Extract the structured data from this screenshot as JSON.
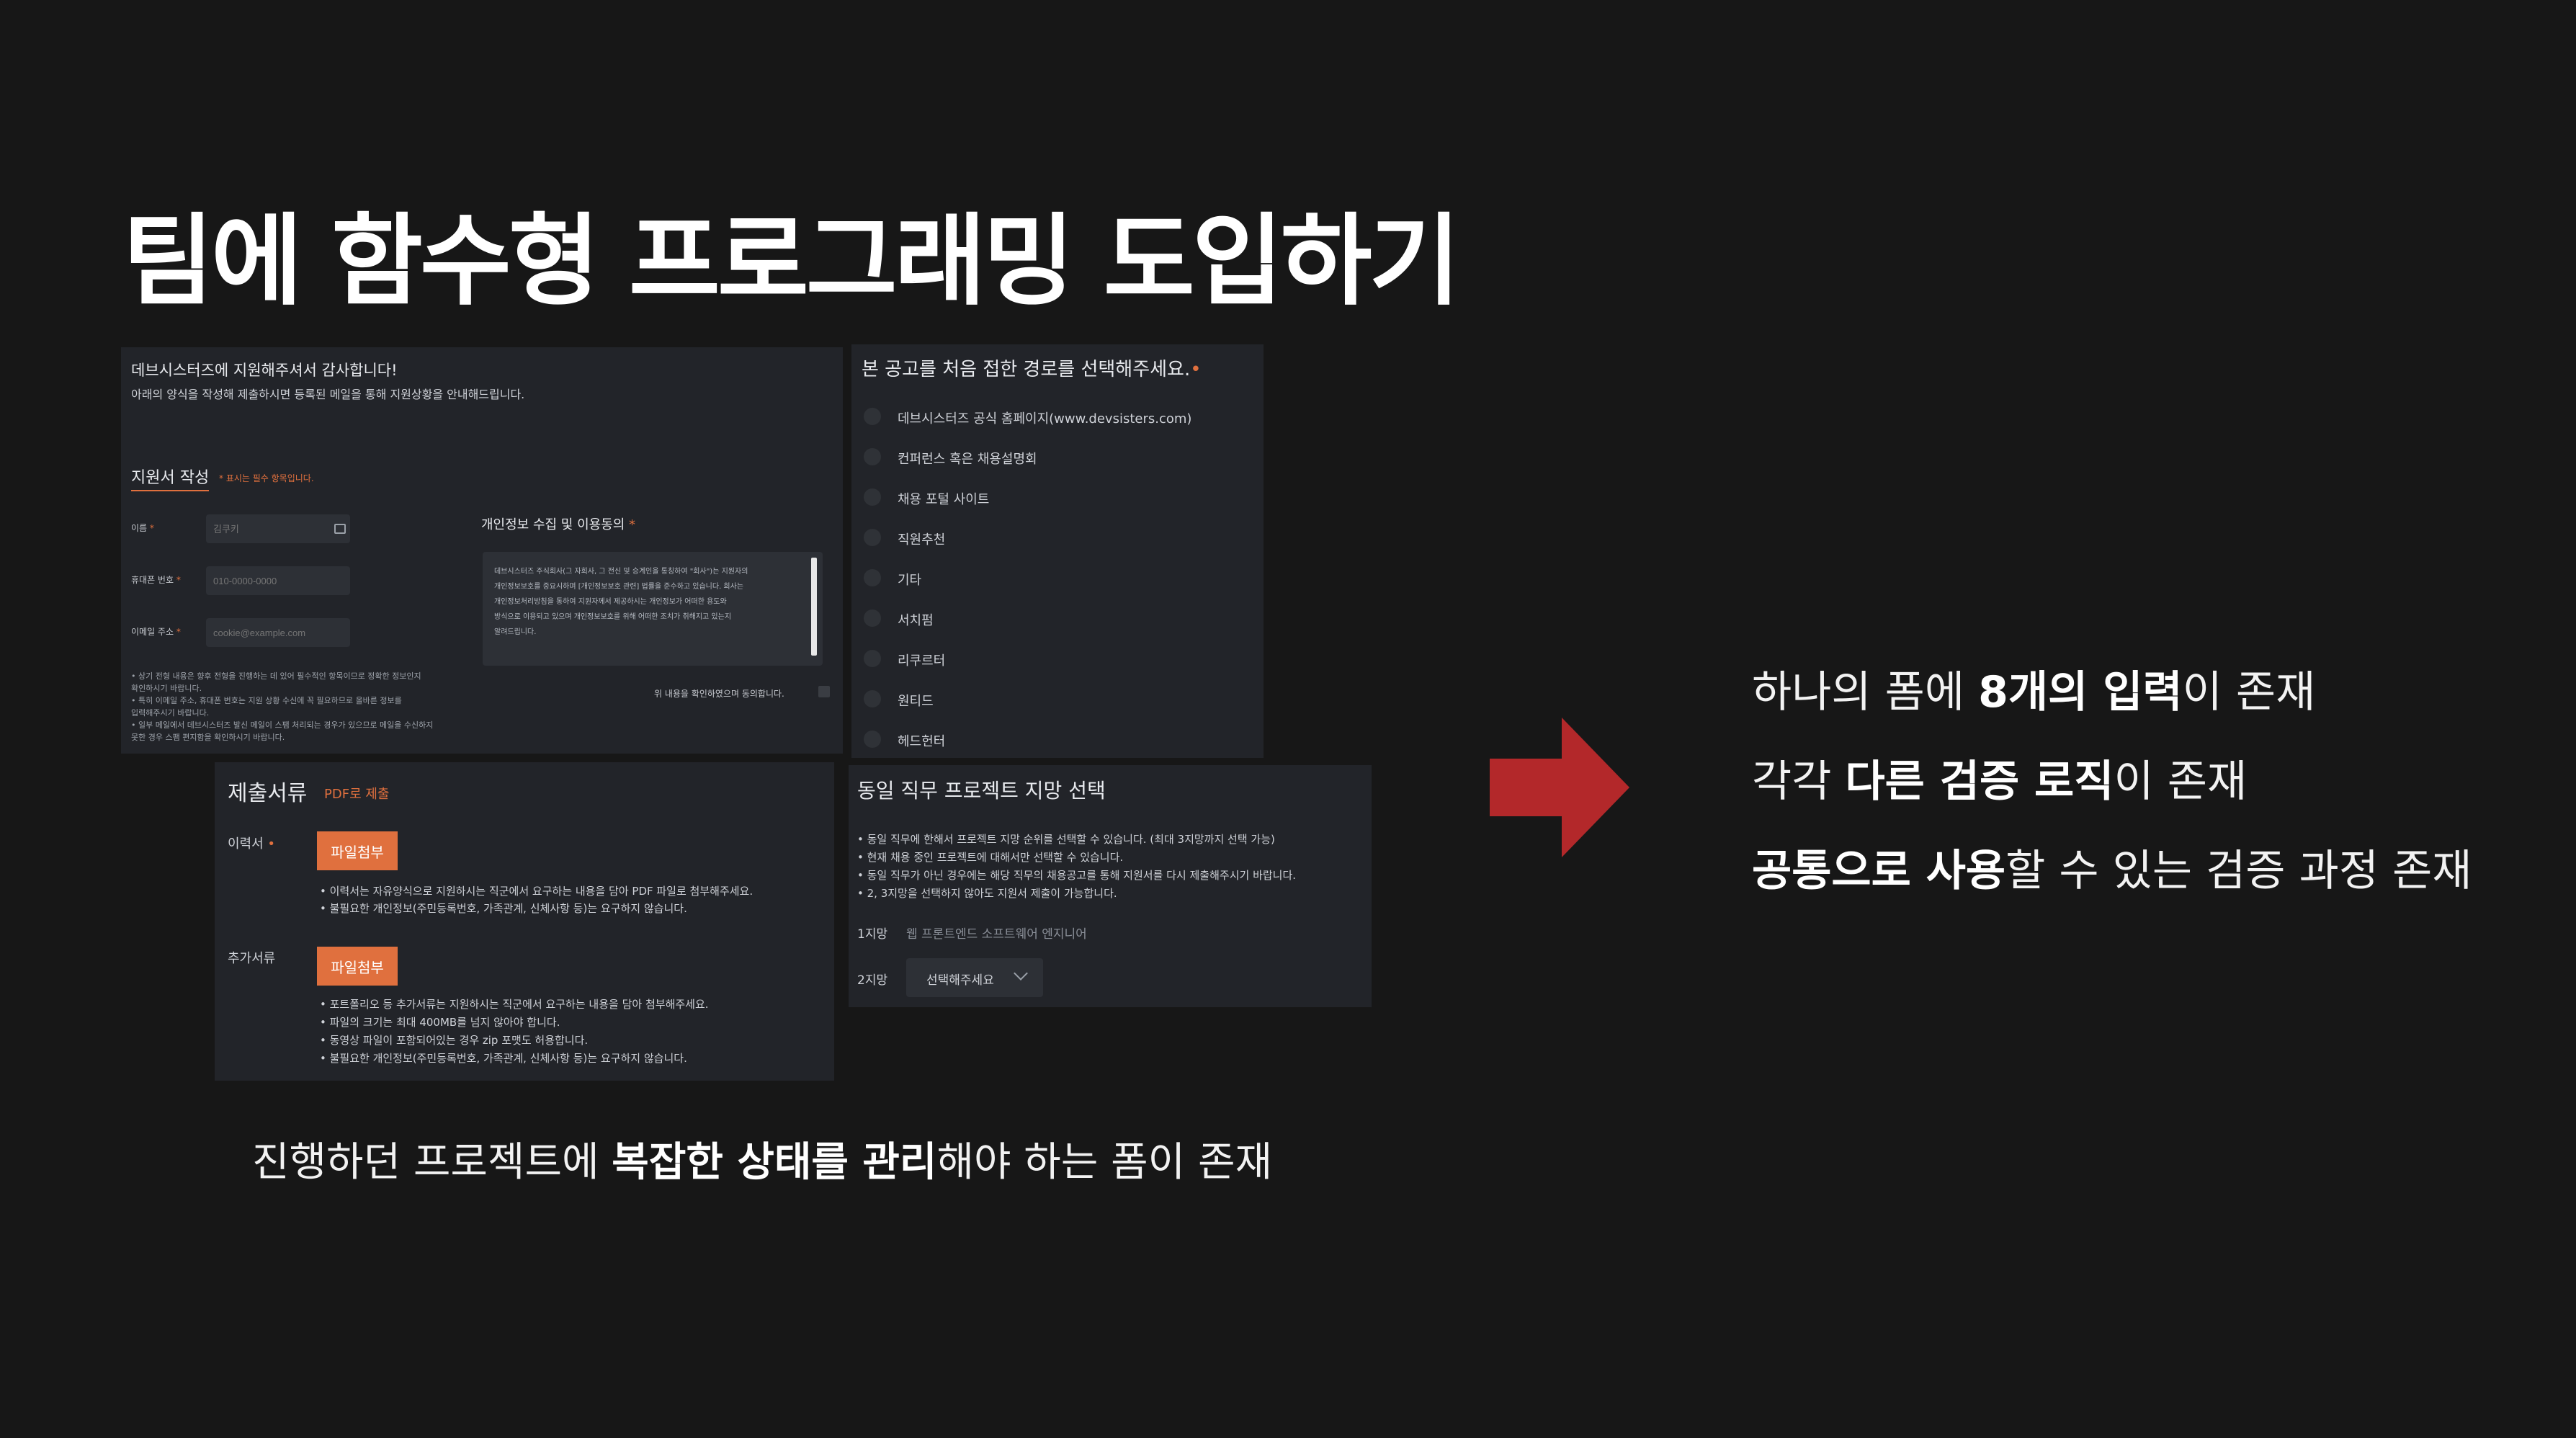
{
  "slide": {
    "title": "팀에 함수형 프로그래밍 도입하기",
    "bullets": [
      {
        "pre": "하나의 폼에 ",
        "bold": "8개의 입력",
        "post": "이 존재"
      },
      {
        "pre": "각각 ",
        "bold": "다른 검증 로직",
        "post": "이 존재"
      },
      {
        "pre": "",
        "bold": "공통으로 사용",
        "post": "할 수 있는 검증 과정 존재"
      }
    ],
    "caption": {
      "pre": "진행하던 프로젝트에 ",
      "bold": "복잡한 상태를 관리",
      "post": "해야 하는 폼이 존재"
    },
    "arrow_color": "#b3282a"
  },
  "form": {
    "heading": "데브시스터즈에 지원해주셔서 감사합니다!",
    "subheading": "아래의 양식을 작성해 제출하시면 등록된 메일을 통해 지원상황을 안내해드립니다.",
    "section_title": "지원서 작성",
    "required_note": "* 표시는 필수 항목입니다.",
    "name_label": "이름",
    "name_placeholder": "김쿠키",
    "phone_label": "휴대폰 번호",
    "phone_placeholder": "010-0000-0000",
    "email_label": "이메일 주소",
    "email_placeholder": "cookie@example.com",
    "notes": [
      "• 상기 전형 내용은 향후 전형을 진행하는 데 있어 필수적인 항목이므로 정확한 정보인지",
      "  확인하시기 바랍니다.",
      "• 특히 이메일 주소, 휴대폰 번호는 지원 상황 수신에 꼭 필요하므로 올바른 정보를",
      "  입력해주시기 바랍니다.",
      "• 일부 메일에서 데브시스터즈 발신 메일이 스팸 처리되는 경우가 있으므로 메일을 수신하지",
      "  못한 경우 스팸 편지함을 확인하시기 바랍니다."
    ],
    "privacy_title": "개인정보 수집 및 이용동의",
    "privacy_text": [
      "데브시스터즈 주식회사(그 자회사, 그 전신 및 승계인을 통칭하여 \"회사\")는 지원자의",
      "개인정보보호를 중요시하며 [개인정보보호 관련] 법률을 준수하고 있습니다. 회사는",
      "개인정보처리방침을 통하여 지원자께서 제공하시는 개인정보가 어떠한 용도와",
      "방식으로 이용되고 있으며 개인정보보호를 위해 어떠한 조치가 취해지고 있는지",
      "알려드립니다."
    ],
    "agree_text": "위 내용을 확인하였으며 동의합니다."
  },
  "source": {
    "question": "본 공고를 처음 접한 경로를 선택해주세요.",
    "options": [
      "데브시스터즈 공식 홈페이지(www.devsisters.com)",
      "컨퍼런스 혹은 채용설명회",
      "채용 포털 사이트",
      "직원추천",
      "기타",
      "서치펌",
      "리쿠르터",
      "원티드",
      "헤드헌터"
    ]
  },
  "docs": {
    "title": "제출서류",
    "note": "PDF로 제출",
    "resume_label": "이력서",
    "extra_label": "추가서류",
    "attach_label": "파일첨부",
    "resume_notes": [
      "• 이력서는 자유양식으로 지원하시는 직군에서 요구하는 내용을 담아 PDF 파일로 첨부해주세요.",
      "• 불필요한 개인정보(주민등록번호, 가족관계, 신체사항 등)는 요구하지 않습니다."
    ],
    "extra_notes": [
      "• 포트폴리오 등 추가서류는 지원하시는 직군에서 요구하는 내용을 담아 첨부해주세요.",
      "• 파일의 크기는 최대 400MB를 넘지 않아야 합니다.",
      "• 동영상 파일이 포함되어있는 경우 zip 포맷도 허용합니다.",
      "• 불필요한 개인정보(주민등록번호, 가족관계, 신체사항 등)는 요구하지 않습니다."
    ]
  },
  "project": {
    "title": "동일 직무 프로젝트 지망 선택",
    "notes": [
      "• 동일 직무에 한해서 프로젝트 지망 순위를 선택할 수 있습니다. (최대 3지망까지 선택 가능)",
      "• 현재 채용 중인 프로젝트에 대해서만 선택할 수 있습니다.",
      "• 동일 직무가 아닌 경우에는 해당 직무의 채용공고를 통해 지원서를 다시 제출해주시기 바랍니다.",
      "• 2, 3지망을 선택하지 않아도 지원서 제출이 가능합니다."
    ],
    "first_label": "1지망",
    "first_value": "웹 프론트엔드 소프트웨어 엔지니어",
    "second_label": "2지망",
    "second_value": "선택해주세요"
  }
}
